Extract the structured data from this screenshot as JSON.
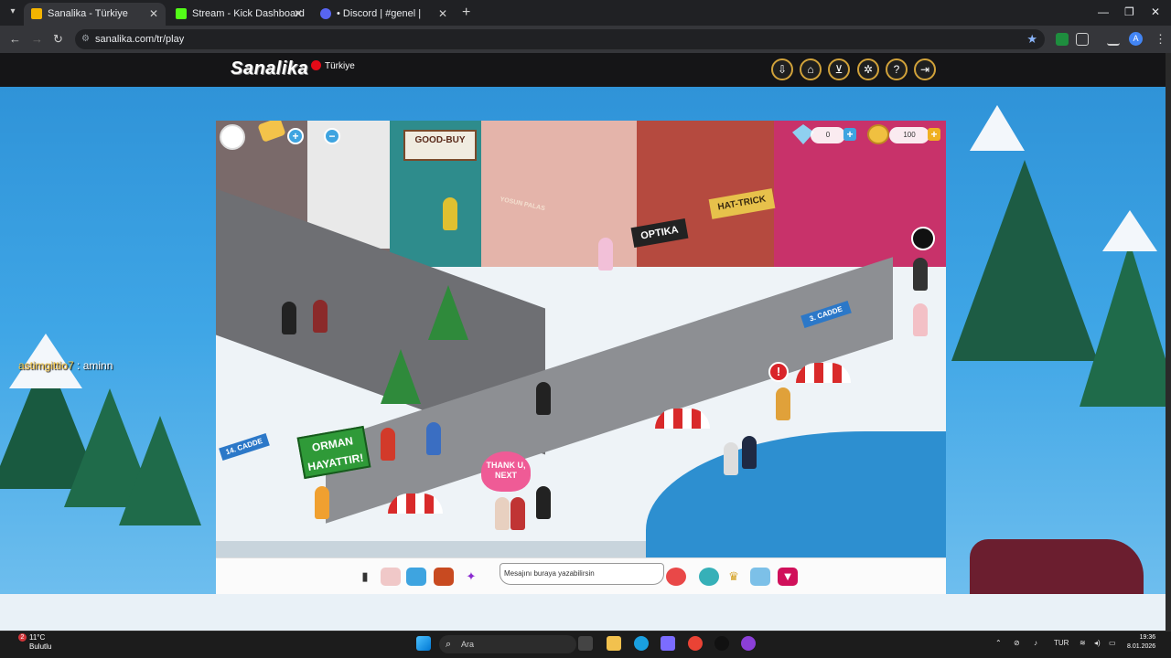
{
  "browser": {
    "tabs": [
      {
        "title": "Sanalika - Türkiye",
        "active": true
      },
      {
        "title": "Stream - Kick Dashboard",
        "active": false
      },
      {
        "title": "• Discord | #genel | survivo",
        "active": false
      }
    ],
    "url": "sanalika.com/tr/play"
  },
  "site": {
    "logo": "Sanalika",
    "region": "Türkiye",
    "header_icons": [
      "download-icon",
      "home-icon",
      "cart-icon",
      "settings-icon",
      "help-icon",
      "logout-icon"
    ]
  },
  "overlay_chat": {
    "nick": "astimgittio7",
    "message": ": aminn"
  },
  "game": {
    "diamonds": "0",
    "coins": "100",
    "shop_signs": [
      "GOOD-BUY",
      "OPTIKA",
      "HAT-TRICK",
      "YOSUN PALAS"
    ],
    "street_signs": [
      "3. CADDE",
      "14. CADDE"
    ],
    "banner": "ORMAN HAYATTIR!",
    "speech_bubble": "THANK U, NEXT",
    "chat_placeholder": "Mesajını buraya yazabilirsin"
  },
  "taskbar": {
    "weather_temp": "11°C",
    "weather_desc": "Bulutlu",
    "weather_badge": "2",
    "search_placeholder": "Ara",
    "language": "TUR",
    "time": "19:36",
    "date": "8.01.2026"
  }
}
